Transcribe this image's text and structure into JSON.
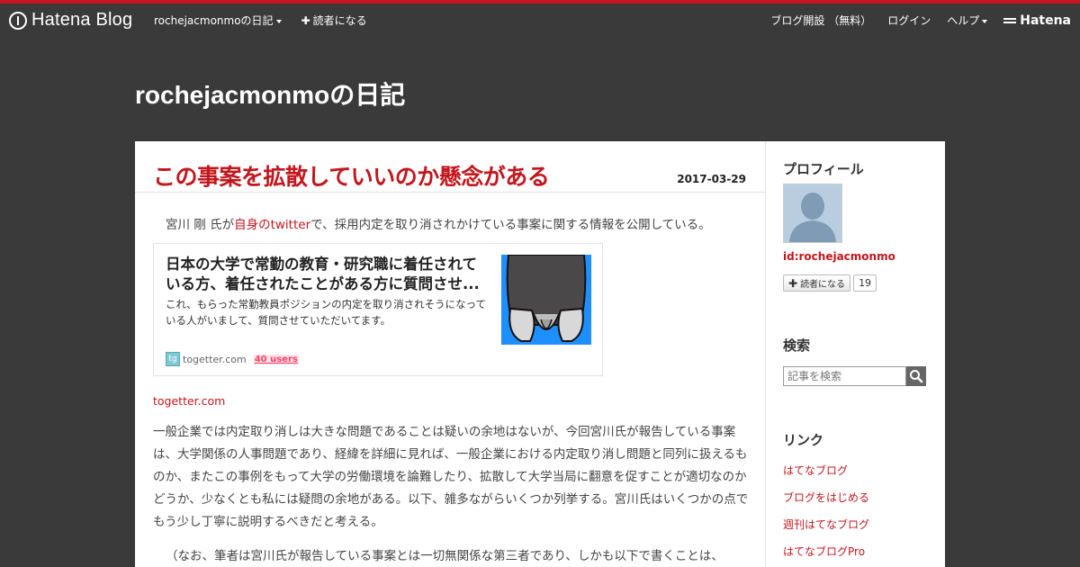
{
  "globalbar": {
    "logo_text": "Hatena Blog",
    "blog_menu_label": "rochejacmonmoの日記",
    "subscribe_label": "読者になる",
    "open_blog_label": "ブログ開設 （無料）",
    "login_label": "ログイン",
    "help_label": "ヘルプ",
    "hatena_label": "Hatena"
  },
  "blog": {
    "title": "rochejacmonmoの日記"
  },
  "entry": {
    "title": "この事案を拡散していいのか懸念がある",
    "date": "2017-03-29",
    "intro_before": "宮川 剛 氏が",
    "intro_link": "自身のtwitter",
    "intro_after": "で、採用内定を取り消されかけている事案に関する情報を公開している。",
    "embed": {
      "title": "日本の大学で常勤の教育・研究職に着任されている方、着任されたことがある方に質問させ...",
      "description": "これ、もらった常勤教員ポジションの内定を取り消されそうになっている人がいまして、質問させていただいてます。",
      "favicon_text": "tg",
      "site": "togetter.com",
      "users": "40 users"
    },
    "source_link": "togetter.com",
    "paragraph1": "一般企業では内定取り消しは大きな問題であることは疑いの余地はないが、今回宮川氏が報告している事案は、大学関係の人事問題であり、経緯を詳細に見れば、一般企業における内定取り消し問題と同列に扱えるものか、またこの事例をもって大学の労働環境を論難したり、拡散して大学当局に翻意を促すことが適切なのかどうか、少なくとも私には疑問の余地がある。以下、雑多ながらいくつか列挙する。宮川氏はいくつかの点でもう少し丁寧に説明するべきだと考える。",
    "paragraph2": "（なお、筆者は宮川氏が報告している事案とは一切無関係な第三者であり、しかも以下で書くことは、"
  },
  "sidebar": {
    "profile_heading": "プロフィール",
    "profile_id": "id:rochejacmonmo",
    "subscribe_label": "読者になる",
    "subscriber_count": "19",
    "search_heading": "検索",
    "search_placeholder": "記事を検索",
    "links_heading": "リンク",
    "links": [
      "はてなブログ",
      "ブログをはじめる",
      "週刊はてなブログ",
      "はてなブログPro"
    ]
  },
  "colors": {
    "accent": "#c4161c",
    "background": "#3a3a3a",
    "header_bar": "#c4161c"
  }
}
